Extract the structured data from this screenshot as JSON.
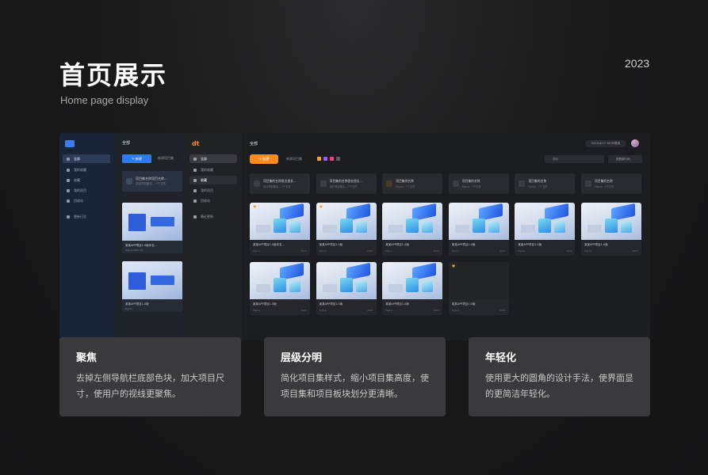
{
  "header": {
    "title": "首页展示",
    "subtitle": "Home page display",
    "year": "2023"
  },
  "old_ui": {
    "nav": [
      "全部",
      "我的收藏",
      "收藏",
      "我的项目",
      "回收站",
      "更新日志"
    ],
    "main_title": "全部",
    "new_button": "+ 新建",
    "tab": "新建项目集",
    "project_set": {
      "title": "项目集名称项目名称...",
      "sub": "项目项目集名... 7个文件"
    },
    "cards": [
      {
        "title": "某某APP项目1.0版本名...",
        "sub": "Figma·2022.12",
        "right": ""
      },
      {
        "title": "某某APP项目1.0版",
        "sub": "Figma",
        "right": ""
      }
    ]
  },
  "new_ui": {
    "logo": "dt",
    "nav": [
      "全部",
      "我的收藏",
      "收藏",
      "我的项目",
      "回收站",
      "最近更新"
    ],
    "main_title": "全部",
    "user": "2022/4/17 18:00登录",
    "new_button": "+ 新建",
    "tab": "新建项目集",
    "search_placeholder": "搜索",
    "filter": "按更新时间",
    "project_sets": [
      {
        "title": "项目集的名称很长很长...",
        "sub": "设计项目集名... 7个文件",
        "star": false
      },
      {
        "title": "项目集的名称很长很长...",
        "sub": "设计项目集名... 7个文件",
        "star": false
      },
      {
        "title": "项目集的名称",
        "sub": "Figma · 7个文件",
        "star": true
      },
      {
        "title": "项目集的名称",
        "sub": "Figma · 7个文件",
        "star": false
      },
      {
        "title": "项目集的名称",
        "sub": "Figma · 7个文件",
        "star": false
      },
      {
        "title": "项目集的名称",
        "sub": "Figma · 7个文件",
        "star": false
      }
    ],
    "design_cards": [
      {
        "title": "某某APP项目1.0版本名...",
        "sub": "Figma",
        "right": "2023",
        "star": true,
        "blank": false
      },
      {
        "title": "某某APP项目1.0版",
        "sub": "Figma",
        "right": "2023",
        "star": true,
        "blank": false
      },
      {
        "title": "某某APP项目1.0版",
        "sub": "Figma",
        "right": "2023",
        "star": false,
        "blank": false
      },
      {
        "title": "某某APP项目1.0版",
        "sub": "Figma",
        "right": "2023",
        "star": false,
        "blank": false
      },
      {
        "title": "某某APP项目1.0版",
        "sub": "Figma",
        "right": "2023",
        "star": false,
        "blank": false
      },
      {
        "title": "某某APP项目1.0版",
        "sub": "Figma",
        "right": "2023",
        "star": false,
        "blank": false
      },
      {
        "title": "某某APP项目1.0版",
        "sub": "Figma",
        "right": "2023",
        "star": false,
        "blank": false
      },
      {
        "title": "某某APP项目1.0版",
        "sub": "Figma",
        "right": "2023",
        "star": false,
        "blank": false
      },
      {
        "title": "某某APP项目1.0版",
        "sub": "Figma",
        "right": "2023",
        "star": false,
        "blank": false
      },
      {
        "title": "某某APP项目1.0版",
        "sub": "Figma",
        "right": "2023",
        "star": true,
        "blank": true
      }
    ]
  },
  "features": [
    {
      "title": "聚焦",
      "text": "去掉左侧导航栏底部色块，加大项目尺寸，使用户的视线更聚焦。"
    },
    {
      "title": "层级分明",
      "text": "简化项目集样式，缩小项目集高度，使项目集和项目板块划分更清晰。"
    },
    {
      "title": "年轻化",
      "text": "使用更大的圆角的设计手法，使界面显的更简洁年轻化。"
    }
  ],
  "colors": {
    "accent_orange": "#ff8c1a",
    "accent_blue": "#2f7af2",
    "card_bg": "#3a3a3c"
  }
}
